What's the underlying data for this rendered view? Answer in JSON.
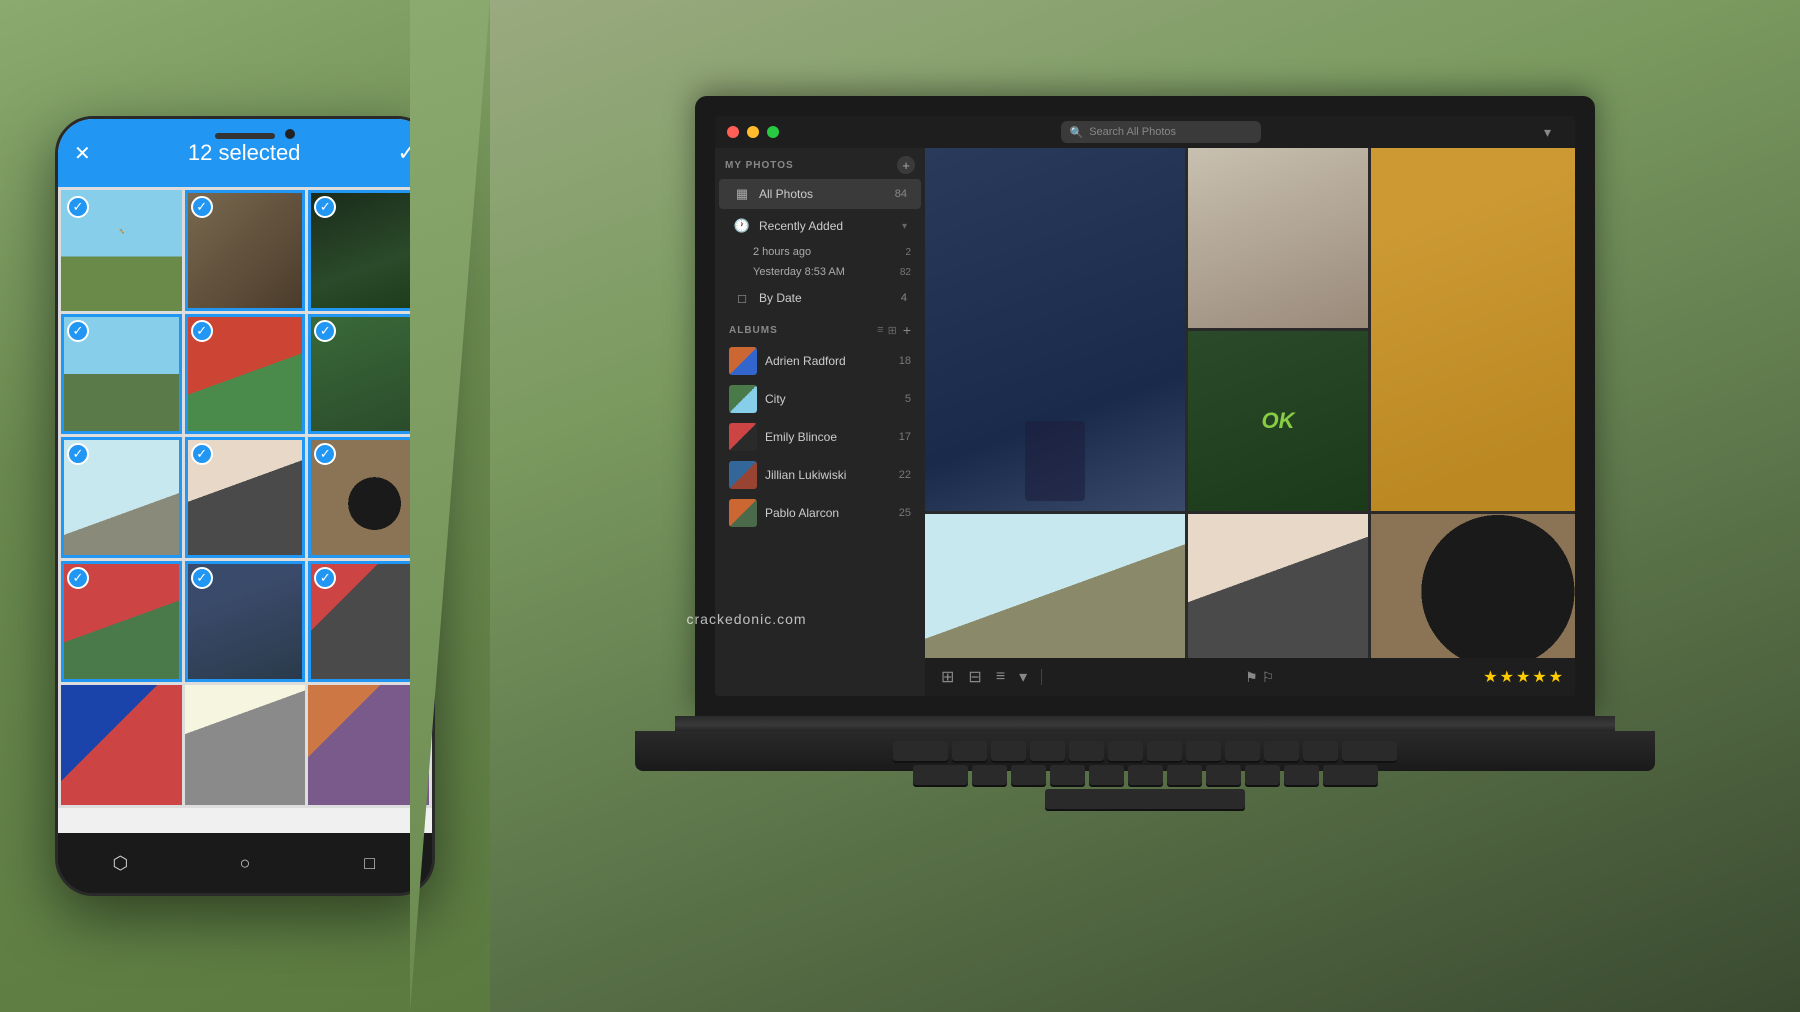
{
  "scene": {
    "watermark": "crackedonic.com"
  },
  "phone": {
    "header": {
      "selected_text": "12 selected",
      "close_icon": "✕",
      "check_icon": "✓"
    },
    "photos": [
      {
        "id": 1,
        "selected": true,
        "color_class": "p1"
      },
      {
        "id": 2,
        "selected": true,
        "color_class": "p2"
      },
      {
        "id": 3,
        "selected": true,
        "color_class": "p3"
      },
      {
        "id": 4,
        "selected": true,
        "color_class": "p4"
      },
      {
        "id": 5,
        "selected": true,
        "color_class": "p5"
      },
      {
        "id": 6,
        "selected": true,
        "color_class": "p6"
      },
      {
        "id": 7,
        "selected": true,
        "color_class": "p7"
      },
      {
        "id": 8,
        "selected": true,
        "color_class": "p8"
      },
      {
        "id": 9,
        "selected": true,
        "color_class": "p9"
      },
      {
        "id": 10,
        "selected": true,
        "color_class": "p10"
      },
      {
        "id": 11,
        "selected": true,
        "color_class": "p11"
      },
      {
        "id": 12,
        "selected": true,
        "color_class": "p12"
      },
      {
        "id": 13,
        "selected": false,
        "color_class": "p13"
      },
      {
        "id": 14,
        "selected": false,
        "color_class": "p14"
      },
      {
        "id": 15,
        "selected": false,
        "color_class": "p15"
      }
    ],
    "nav": [
      "⬡",
      "○",
      "□"
    ]
  },
  "mac": {
    "titlebar": {
      "search_placeholder": "Search All Photos",
      "filter_icon": "▾"
    },
    "sidebar": {
      "my_photos_label": "MY PHOTOS",
      "add_icon": "+",
      "items": [
        {
          "label": "All Photos",
          "count": "84",
          "icon": "▦",
          "active": true
        }
      ],
      "recently_added": {
        "label": "Recently Added",
        "expand_icon": "▾",
        "sub_items": [
          {
            "label": "2 hours ago",
            "count": "2"
          },
          {
            "label": "Yesterday 8:53 AM",
            "count": "82"
          }
        ]
      },
      "by_date": {
        "label": "By Date",
        "count": "4",
        "icon": "□"
      },
      "albums_label": "ALBUMS",
      "albums_view1": "≡",
      "albums_view2": "⊞",
      "albums_add": "+",
      "albums": [
        {
          "label": "Adrien Radford",
          "count": "18",
          "color_class": "at1"
        },
        {
          "label": "City",
          "count": "5",
          "color_class": "at2"
        },
        {
          "label": "Emily Blincoe",
          "count": "17",
          "color_class": "at3"
        },
        {
          "label": "Jillian Lukiwiski",
          "count": "22",
          "color_class": "at4"
        },
        {
          "label": "Pablo Alarcon",
          "count": "25",
          "color_class": "at5"
        }
      ]
    },
    "main": {
      "all_photos_label": "All Photos",
      "recently_added_label": "Recently Added",
      "city_label": "City",
      "two_hours_ago": "2 hours ago"
    },
    "bottom_bar": {
      "icons": [
        "⊞",
        "⊟",
        "≡",
        "▾"
      ],
      "flag_icons": [
        "⚑",
        "⚐"
      ],
      "stars": [
        "★",
        "★",
        "★",
        "★",
        "★"
      ]
    }
  }
}
